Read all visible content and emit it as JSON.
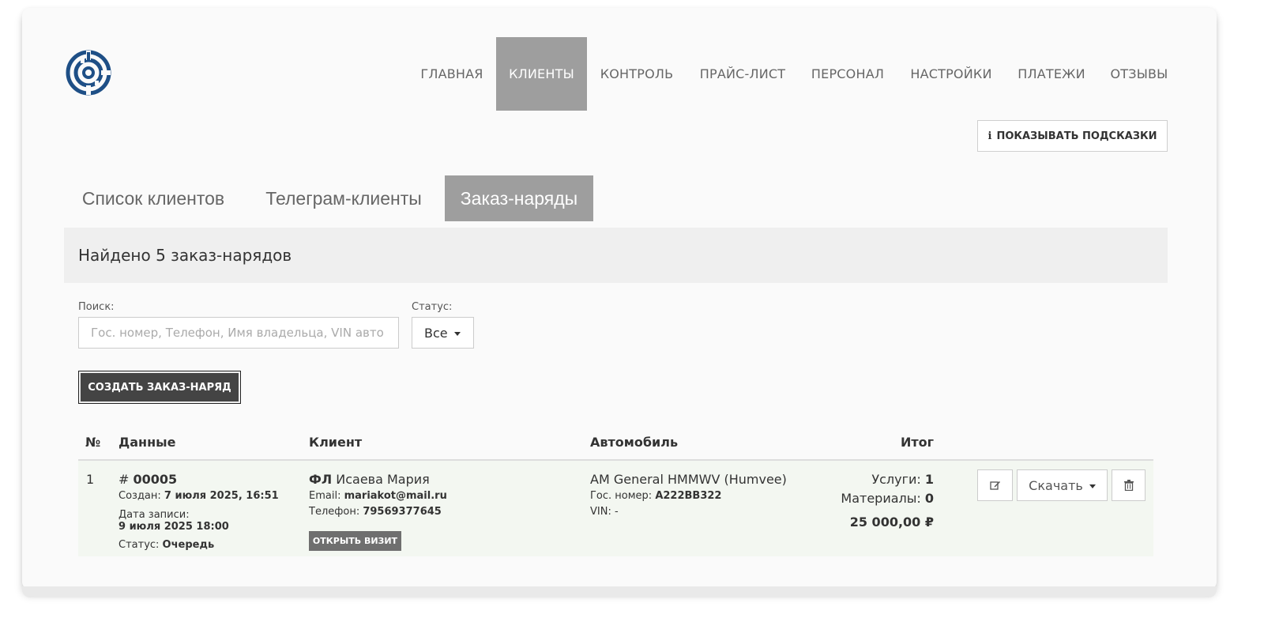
{
  "nav": {
    "items": [
      {
        "label": "ГЛАВНАЯ"
      },
      {
        "label": "КЛИЕНТЫ"
      },
      {
        "label": "КОНТРОЛЬ"
      },
      {
        "label": "ПРАЙС-ЛИСТ"
      },
      {
        "label": "ПЕРСОНАЛ"
      },
      {
        "label": "НАСТРОЙКИ"
      },
      {
        "label": "ПЛАТЕЖИ"
      },
      {
        "label": "ОТЗЫВЫ"
      }
    ],
    "active": "КЛИЕНТЫ"
  },
  "hints": {
    "label": "ПОКАЗЫВАТЬ ПОДСКАЗКИ",
    "icon": "info-icon"
  },
  "tabs": [
    {
      "label": "Список клиентов"
    },
    {
      "label": "Телеграм-клиенты"
    },
    {
      "label": "Заказ-наряды"
    }
  ],
  "panel": {
    "title": "Найдено 5 заказ-нарядов"
  },
  "filters": {
    "search_label": "Поиск:",
    "search_placeholder": "Гос. номер, Телефон, Имя владельца, VIN авто",
    "status_label": "Статус:",
    "status_value": "Все"
  },
  "create_button": "СОЗДАТЬ ЗАКАЗ-НАРЯД",
  "table": {
    "headers": [
      "№",
      "Данные",
      "Клиент",
      "Автомобиль",
      "Итог"
    ],
    "rows": [
      {
        "num": "1",
        "order_prefix": "# ",
        "order_no": "00005",
        "created_label": "Создан: ",
        "created": "7 июля 2025, 16:51",
        "appointment_label": "Дата записи:",
        "appointment": "9 июля 2025 18:00",
        "status_label": "Статус: ",
        "status": "Очередь",
        "client_type": "ФЛ",
        "client_name": "Исаева Мария",
        "email_label": "Email: ",
        "email": "mariakot@mail.ru",
        "phone_label": "Телефон: ",
        "phone": "79569377645",
        "open_visit": "ОТКРЫТЬ ВИЗИТ",
        "car": "AM General HMMWV (Humvee)",
        "plate_label": "Гос. номер: ",
        "plate": "А222ВВ322",
        "vin_label": "VIN: ",
        "vin": "-",
        "services_label": "Услуги: ",
        "services": "1",
        "materials_label": "Материалы: ",
        "materials": "0",
        "total": "25 000,00 ₽",
        "download": "Скачать"
      }
    ]
  }
}
